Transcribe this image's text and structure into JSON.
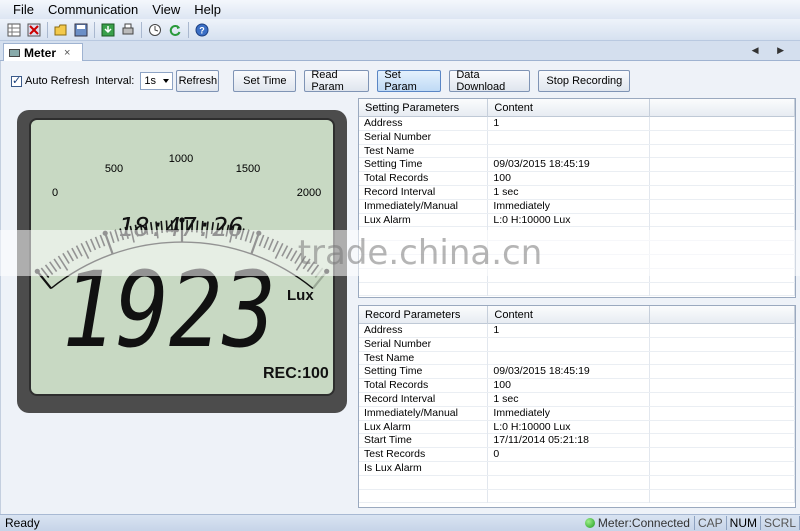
{
  "menu": [
    "File",
    "Communication",
    "View",
    "Help"
  ],
  "toolbar": {
    "icons": [
      "grid-icon",
      "disconnect-icon",
      "open-folder-icon",
      "save-icon",
      "download-icon",
      "print-icon",
      "clock-icon",
      "refresh-icon",
      "help-icon"
    ]
  },
  "tab": {
    "label": "Meter",
    "close": "×",
    "nav": "◀ ▶"
  },
  "controls": {
    "auto_refresh": "Auto Refresh",
    "auto_refresh_checked": true,
    "interval_label": "Interval:",
    "interval_value": "1s",
    "refresh": "Refresh",
    "set_time": "Set Time",
    "read_param": "Read Param",
    "set_param": "Set Param",
    "data_download": "Data Download",
    "stop_recording": "Stop Recording"
  },
  "lcd": {
    "scale_labels": [
      "0",
      "500",
      "1000",
      "1500",
      "2000"
    ],
    "bar_level": 0.96,
    "time": "18:47:26",
    "reading": "1923",
    "unit": "Lux",
    "rec": "REC:100"
  },
  "setting_table": {
    "headers": [
      "Setting Parameters",
      "Content",
      ""
    ],
    "rows": [
      [
        "Address",
        "1"
      ],
      [
        "Serial Number",
        ""
      ],
      [
        "Test Name",
        ""
      ],
      [
        "Setting Time",
        "09/03/2015 18:45:19"
      ],
      [
        "Total Records",
        "100"
      ],
      [
        "Record Interval",
        "1 sec"
      ],
      [
        "Immediately/Manual",
        "Immediately"
      ],
      [
        "Lux Alarm",
        "L:0 H:10000 Lux"
      ]
    ]
  },
  "record_table": {
    "headers": [
      "Record Parameters",
      "Content",
      ""
    ],
    "rows": [
      [
        "Address",
        "1"
      ],
      [
        "Serial Number",
        ""
      ],
      [
        "Test Name",
        ""
      ],
      [
        "Setting Time",
        "09/03/2015 18:45:19"
      ],
      [
        "Total Records",
        "100"
      ],
      [
        "Record Interval",
        "1 sec"
      ],
      [
        "Immediately/Manual",
        "Immediately"
      ],
      [
        "Lux Alarm",
        "L:0 H:10000 Lux"
      ],
      [
        "Start Time",
        "17/11/2014 05:21:18"
      ],
      [
        "Test Records",
        "0"
      ],
      [
        "Is Lux Alarm",
        ""
      ]
    ]
  },
  "watermark": "trade.china.cn",
  "status": {
    "ready": "Ready",
    "connection": "Meter:Connected",
    "keys": [
      "CAP",
      "NUM",
      "SCRL"
    ],
    "keys_on": [
      "NUM"
    ]
  }
}
